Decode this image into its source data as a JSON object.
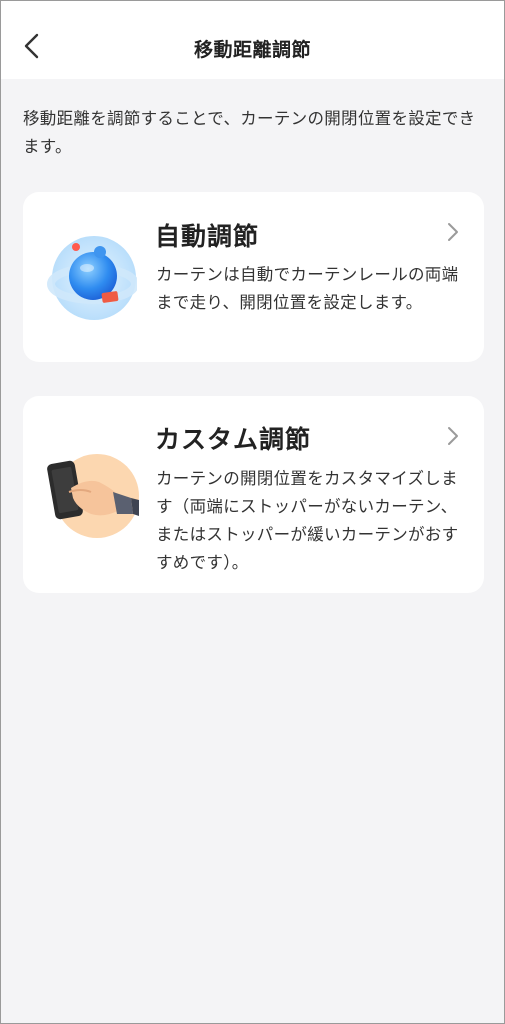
{
  "header": {
    "title": "移動距離調節",
    "back_icon": "chevron-left-icon"
  },
  "description": "移動距離を調節することで、カーテンの開閉位置を設定できます。",
  "cards": [
    {
      "title": "自動調節",
      "description": "カーテンは自動でカーテンレールの両端まで走り、開閉位置を設定します。",
      "illustration": "auto-adjust-orb-icon",
      "arrow_icon": "chevron-right-icon"
    },
    {
      "title": "カスタム調節",
      "description": "カーテンの開閉位置をカスタマイズします（両端にストッパーがないカーテン、またはストッパーが緩いカーテンがおすすめです）。",
      "illustration": "hand-holding-phone-icon",
      "arrow_icon": "chevron-right-icon"
    }
  ],
  "colors": {
    "background": "#f4f4f6",
    "card": "#ffffff",
    "text": "#2b2b2b",
    "chevron": "#9a9a9a"
  }
}
